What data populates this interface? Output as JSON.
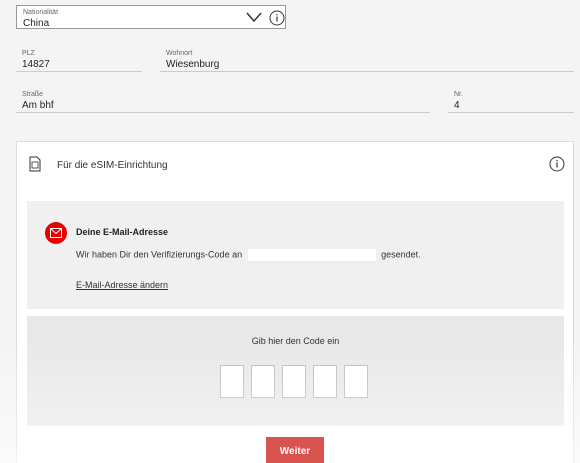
{
  "address": {
    "nationality": {
      "label": "Nationalität",
      "value": "China"
    },
    "plz": {
      "label": "PLZ",
      "value": "14827"
    },
    "wohnort": {
      "label": "Wohnort",
      "value": "Wiesenburg"
    },
    "strasse": {
      "label": "Straße",
      "value": "Am bhf"
    },
    "nr": {
      "label": "Nr.",
      "value": "4"
    }
  },
  "esim": {
    "title": "Für die eSIM-Einrichtung",
    "email_box": {
      "heading": "Deine E-Mail-Adresse",
      "message_before": "Wir haben Dir den Verifizierungs-Code an",
      "message_after": "gesendet.",
      "change_link": "E-Mail-Adresse ändern"
    },
    "code": {
      "prompt": "Gib hier den Code ein",
      "cells": [
        "",
        "",
        "",
        "",
        ""
      ]
    }
  },
  "submit_label": "Weiter",
  "icons": {
    "chevron": "chevron-down-icon",
    "info": "info-icon",
    "sim": "sim-card-icon",
    "mail": "mail-icon"
  },
  "colors": {
    "accent": "#e60000",
    "button": "#d9534f"
  }
}
